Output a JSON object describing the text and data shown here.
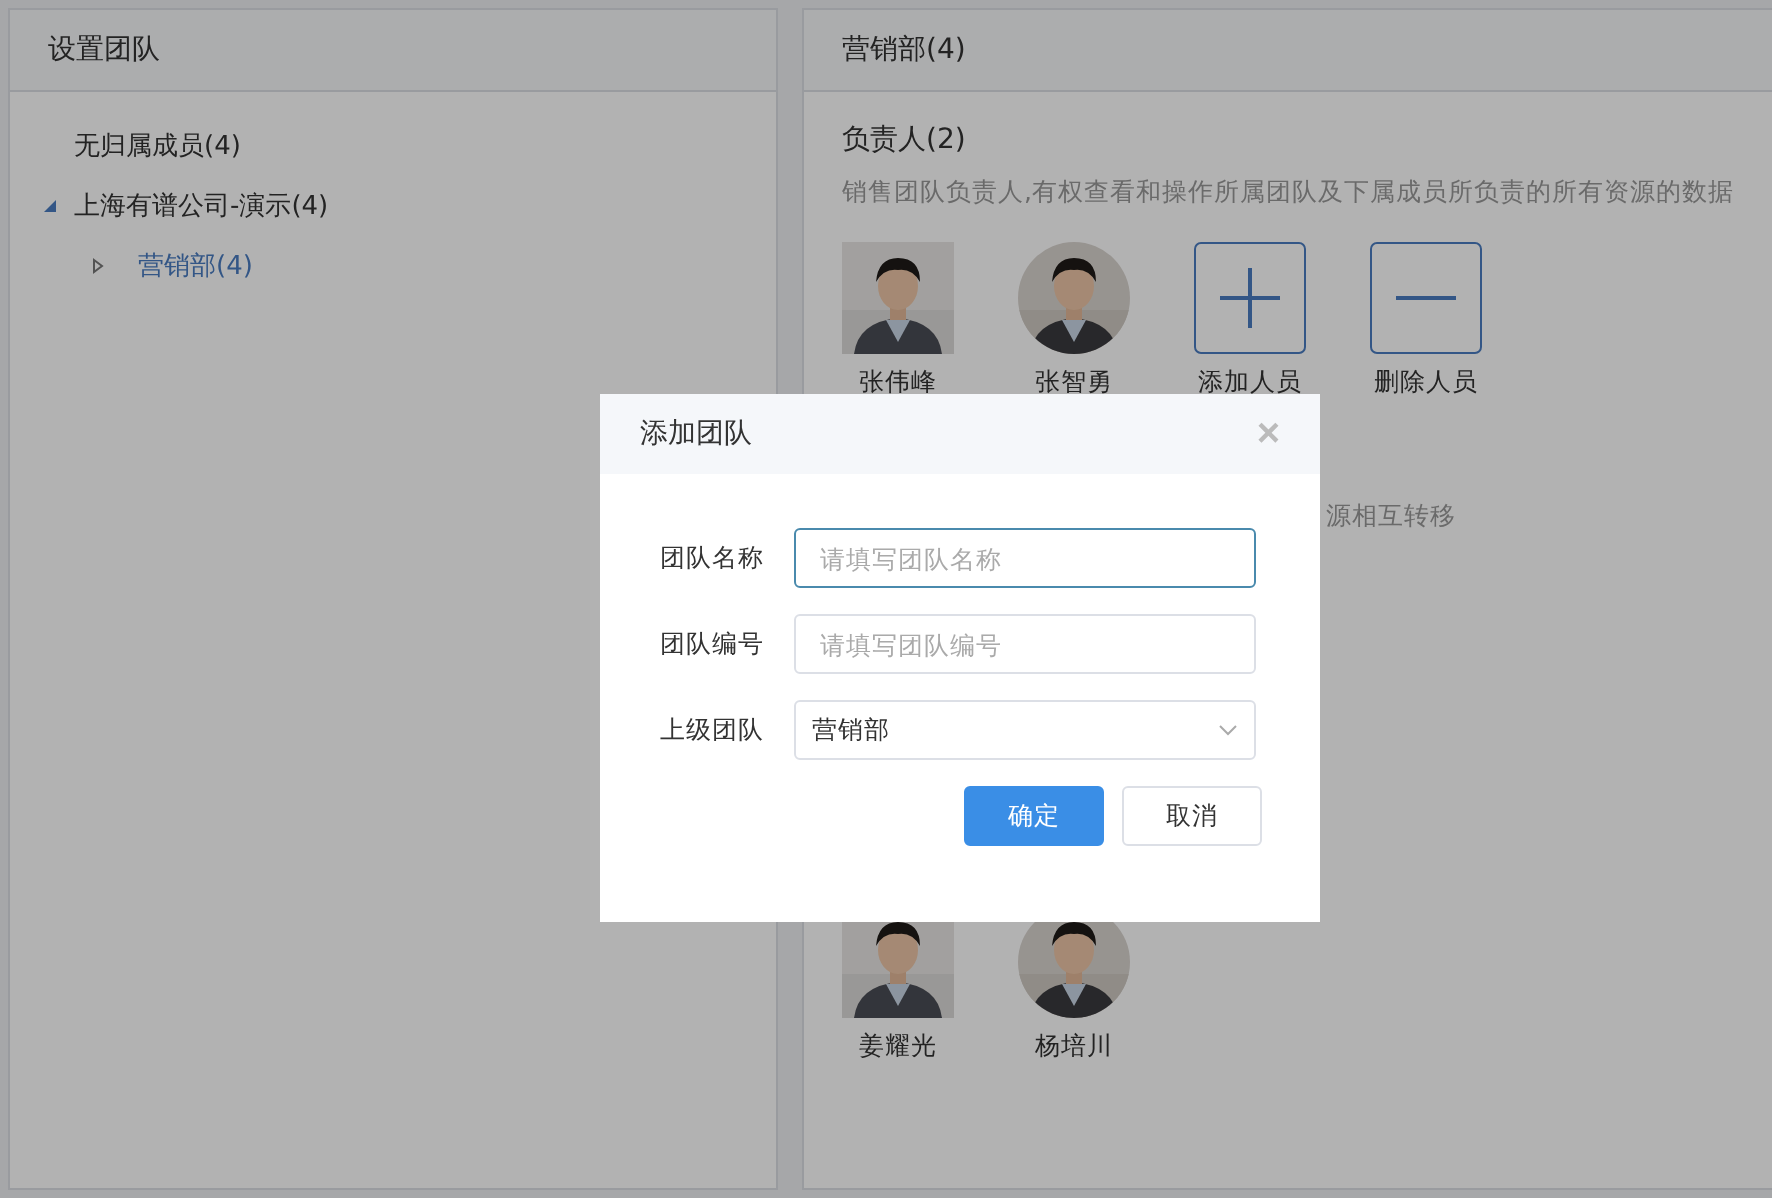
{
  "left_panel": {
    "title": "设置团队",
    "tree": [
      {
        "label": "无归属成员(4)",
        "expandable": false,
        "selected": false
      },
      {
        "label": "上海有谱公司-演示(4)",
        "expandable": true,
        "expanded": true,
        "selected": false,
        "children": [
          {
            "label": "营销部(4)",
            "expandable": true,
            "expanded": false,
            "selected": true
          }
        ]
      }
    ]
  },
  "right_panel": {
    "title": "营销部(4)",
    "leaders": {
      "title": "负责人(2)",
      "description": "销售团队负责人,有权查看和操作所属团队及下属成员所负责的所有资源的数据",
      "members": [
        {
          "name": "张伟峰",
          "round": false
        },
        {
          "name": "张智勇",
          "round": true
        }
      ],
      "actions": [
        {
          "kind": "add",
          "label": "添加人员"
        },
        {
          "kind": "remove",
          "label": "删除人员"
        }
      ]
    },
    "partial_text": "源相互转移",
    "members": [
      {
        "name": "姜耀光",
        "round": false
      },
      {
        "name": "杨培川",
        "round": true
      }
    ]
  },
  "dialog": {
    "title": "添加团队",
    "close": "×",
    "fields": [
      {
        "kind": "input",
        "label": "团队名称",
        "placeholder": "请填写团队名称",
        "focused": true
      },
      {
        "kind": "input",
        "label": "团队编号",
        "placeholder": "请填写团队编号",
        "focused": false
      },
      {
        "kind": "select",
        "label": "上级团队",
        "value": "营销部"
      }
    ],
    "buttons": [
      {
        "kind": "primary",
        "label": "确定"
      },
      {
        "kind": "default",
        "label": "取消"
      }
    ]
  }
}
